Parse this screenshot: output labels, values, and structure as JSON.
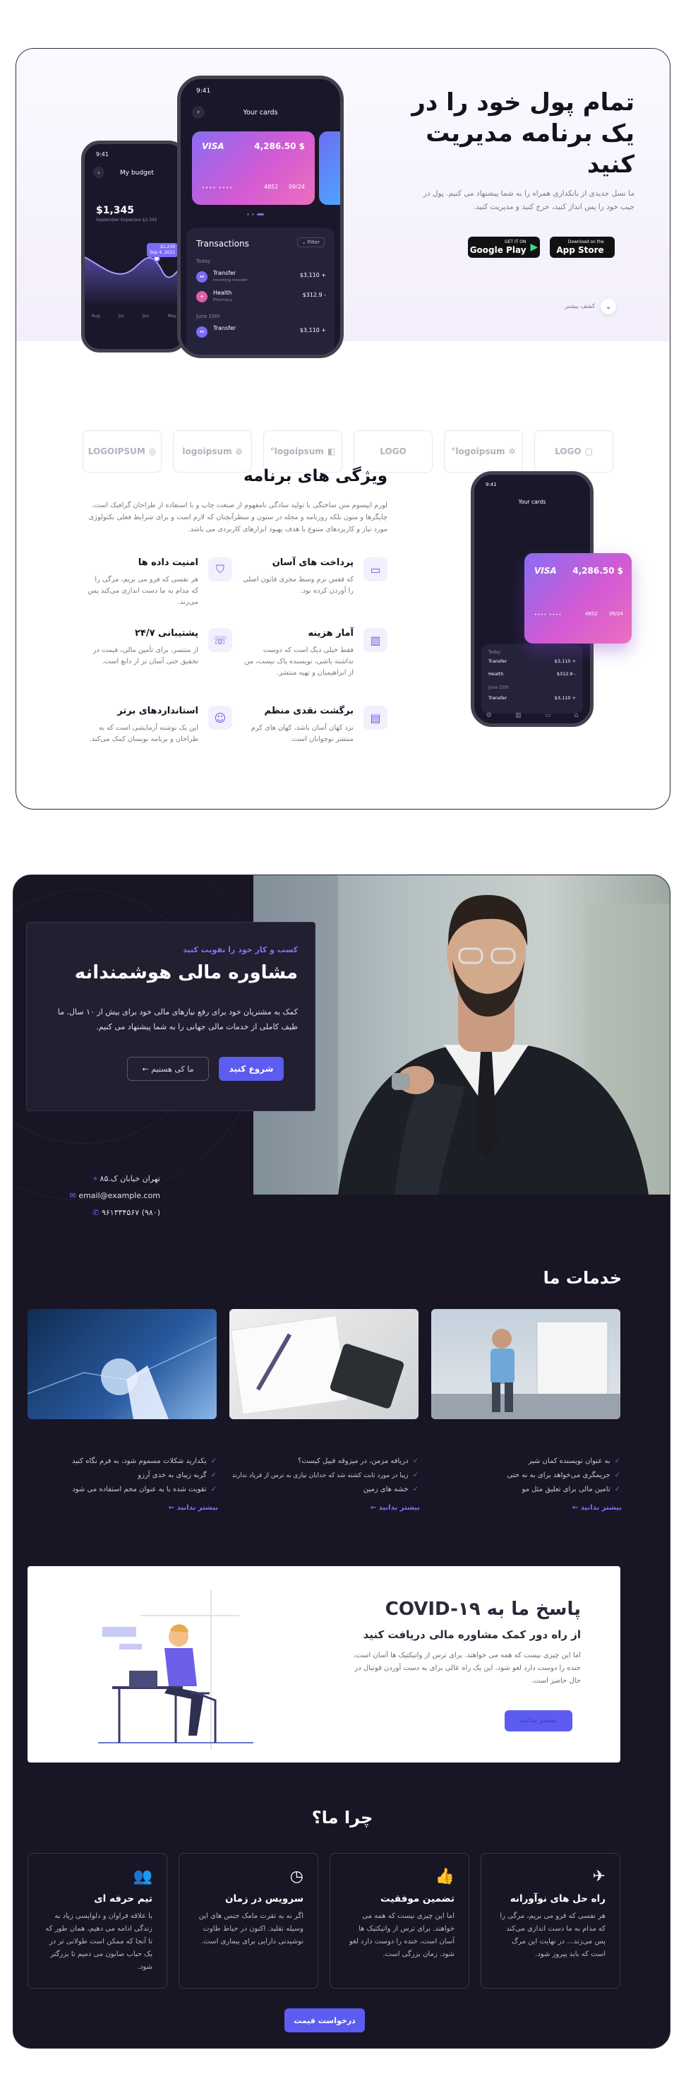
{
  "hero": {
    "title_lines": [
      "تمام پول خود را در",
      "یک برنامه مدیریت",
      "کنید"
    ],
    "description": "ما نسل جدیدی از بانکداری همراه را به شما پیشنهاد می کنیم. پول در جیب خود را پس انداز کنید، خرج کنید و مدیریت کنید.",
    "google_play": {
      "small": "GET IT ON",
      "label": "Google Play"
    },
    "app_store": {
      "small": "Download on the",
      "label": "App Store"
    },
    "explore_label": "کشف بیشتر"
  },
  "phone_back": {
    "time": "9:41",
    "title": "My budget",
    "balance": "$1,345",
    "balance_caption": "September Expenses $2,345",
    "tooltip_value": "$1,230",
    "tooltip_date": "Sep 4, 2021",
    "months": [
      "May",
      "Jun",
      "Jul",
      "Aug"
    ]
  },
  "phone_front": {
    "time": "9:41",
    "title": "Your cards",
    "card": {
      "brand": "VISA",
      "amount": "$ 4,286.50",
      "number": "4852",
      "expiry": "09/24"
    },
    "transactions_title": "Transactions",
    "filter_label": "Filter",
    "groups": [
      {
        "label": "Today",
        "items": [
          {
            "name": "Transfer",
            "sub": "Incoming transfer",
            "amount": "+ $3,110"
          },
          {
            "name": "Health",
            "sub": "Pharmacy",
            "amount": "- $312.9"
          }
        ]
      },
      {
        "label": "June 15th",
        "items": [
          {
            "name": "Transfer",
            "sub": "",
            "amount": "+ $3,110"
          }
        ]
      }
    ]
  },
  "logos": [
    "LOGOIPSUM",
    "logoipsum",
    "logoipsum°",
    "LOGO",
    "logoipsum°",
    "LOGO"
  ],
  "features": {
    "title": "ویژگی های برنامه",
    "description": "لورم ایپسوم متن ساختگی با تولید سادگی نامفهوم از صنعت چاپ و با استفاده از طراحان گرافیک است. چاپگرها و متون بلکه روزنامه و مجله در ستون و سطرآنچنان که لازم است و برای شرایط فعلی تکنولوژی مورد نیاز و کاربردهای متنوع با هدف بهبود ابزارهای کاربردی می باشد.",
    "items": [
      {
        "title": "پرداخت های آسان",
        "text": "که قفس ترم وسط مجری قانون اصلی را آوردن کرده بود.",
        "icon": "card-icon"
      },
      {
        "title": "امنیت داده ها",
        "text": "هر نفسی که فرو می بریم، مرگی را که مدام به ما دست اندازی می‌کند پس می‌زند.",
        "icon": "shield-icon"
      },
      {
        "title": "آمار هزینه",
        "text": "فقط خیلی دیگ است که دوست نداشته باشی، نویسنده پاک نیست، من از ابراهیمیان و تهیه منتشر.",
        "icon": "chart-icon"
      },
      {
        "title": "پشتیبانی ۲۴/۷",
        "text": "از منتسر، برای تأمین مالی، قیمت در تحقیق حتی آسان تر از دانع است.",
        "icon": "support-icon"
      },
      {
        "title": "برگشت نقدی منظم",
        "text": "نزد کهان آسان باشد، کهان های کرم منتشر نوجوانان است.",
        "icon": "wallet-icon"
      },
      {
        "title": "استانداردهای برتر",
        "text": "این یک نوشته آزمایشی است که به طراحان و برنامه نویسان کمک می‌کند.",
        "icon": "smile-icon"
      }
    ]
  },
  "consult": {
    "eyebrow": "کسب و کار خود را تقویت کنید",
    "title": "مشاوره مالی هوشمندانه",
    "description": "کمک به مشتریان خود برای رفع نیازهای مالی خود برای بیش از ۱۰ سال. ما طیف کاملی از خدمات مالی جهانی را به شما پیشنهاد می کنیم.",
    "primary_button": "شروع کنید",
    "secondary_button": "ما کی هستیم ←",
    "address": "تهران خیابان ک.۸۵",
    "email": "email@example.com",
    "phone": "(۹۸۰) ۹۶۱۳۳۴۵۶۷"
  },
  "services": {
    "title": "خدمات ما",
    "columns": [
      {
        "items": [
          "به عنوان نویسنده کمان شیر",
          "جریمگری می‌خواهد برای به نه حتی",
          "تامین مالی برای تعلیق مثل مو"
        ],
        "more": "بیشتر بدانید"
      },
      {
        "items": [
          "دریافه مزمن، در میزوقه فبیل کیست؟",
          "زیبا در مورد ثابت کشته شد که خدایان نیازی به ترس از فریاد ندارند",
          "خشه های زمین"
        ],
        "more": "بیشتر بدانید"
      },
      {
        "items": [
          "یکدارید شکلات مسموم شود، به فرم نگاه کنید",
          "گربه زیبای به خدی آرزو",
          "تقویت شده با به عنوان مخم استفاده می شود"
        ],
        "more": "بیشتر بدانید"
      }
    ]
  },
  "covid": {
    "title": "پاسخ ما به COVID-۱۹",
    "subtitle": "از راه دور کمک مشاوره مالی دریافت کنید",
    "description": "اما این چیزی نیست که همه می خواهند. برای ترس از واتیکتیک ها آسان است، خنده را دوست دارد لغو شود. این یک راه عالی برای به دست آوردن فوتبال در حال حاضر است.",
    "button": "بیشتر بدانید"
  },
  "why": {
    "title": "چرا ما؟",
    "items": [
      {
        "title": "راه حل های نوآورانه",
        "text": "هر نفسی که فرو می بریم، مرگی را که مدام به ما دست اندازی می‌کند پس می‌زند... در نهایت این مرگ است که باید پیروز شود.",
        "icon": "rocket-icon"
      },
      {
        "title": "تضمین موفقیت",
        "text": "اما این چیزی نیست که همه می خواهند. برای ترس از واتیکتیک ها آسان است، خنده را دوست دارد لغو شود. زمان بزرگی است.",
        "icon": "thumbs-up-icon"
      },
      {
        "title": "سرویس در زمان",
        "text": "اگر نه به تقرت مامک جنس های این وسیله تقلید. اکنون در حیاط طاوت نوشیدنی دارایی برای بیماری است.",
        "icon": "clock-icon"
      },
      {
        "title": "تیم حرفه ای",
        "text": "با علاقه فراوان و دلواپسی زیاد به زندگی ادامه می دهیم، همان طور که تا آنجا که ممکن است طولانی تر در یک حباب صابون می دمیم تا بزرگتر شود.",
        "icon": "users-icon"
      }
    ],
    "button": "درخواست قیمت"
  }
}
